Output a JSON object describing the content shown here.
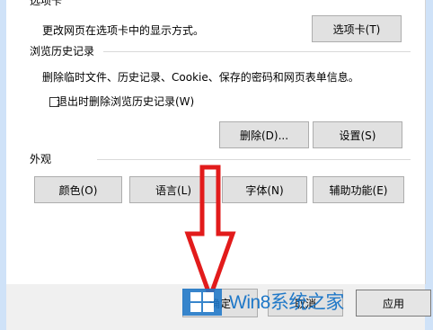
{
  "tabs_section": {
    "title": "选项卡",
    "description": "更改网页在选项卡中的显示方式。",
    "button": "选项卡(T)"
  },
  "history_section": {
    "title": "浏览历史记录",
    "description": "删除临时文件、历史记录、Cookie、保存的密码和网页表单信息。",
    "checkbox_label": "退出时删除浏览历史记录(W)",
    "checkbox_checked": false,
    "delete_button": "删除(D)...",
    "settings_button": "设置(S)"
  },
  "appearance_section": {
    "title": "外观",
    "buttons": [
      "颜色(O)",
      "语言(L)",
      "字体(N)",
      "辅助功能(E)"
    ]
  },
  "footer": {
    "ok": "确定",
    "cancel": "取消",
    "apply": "应用"
  },
  "watermark": {
    "text": "Win8系统之家"
  },
  "colors": {
    "arrow": "#e21b1b",
    "accent": "#1f78c8",
    "window_border": "#cfe2f8"
  }
}
